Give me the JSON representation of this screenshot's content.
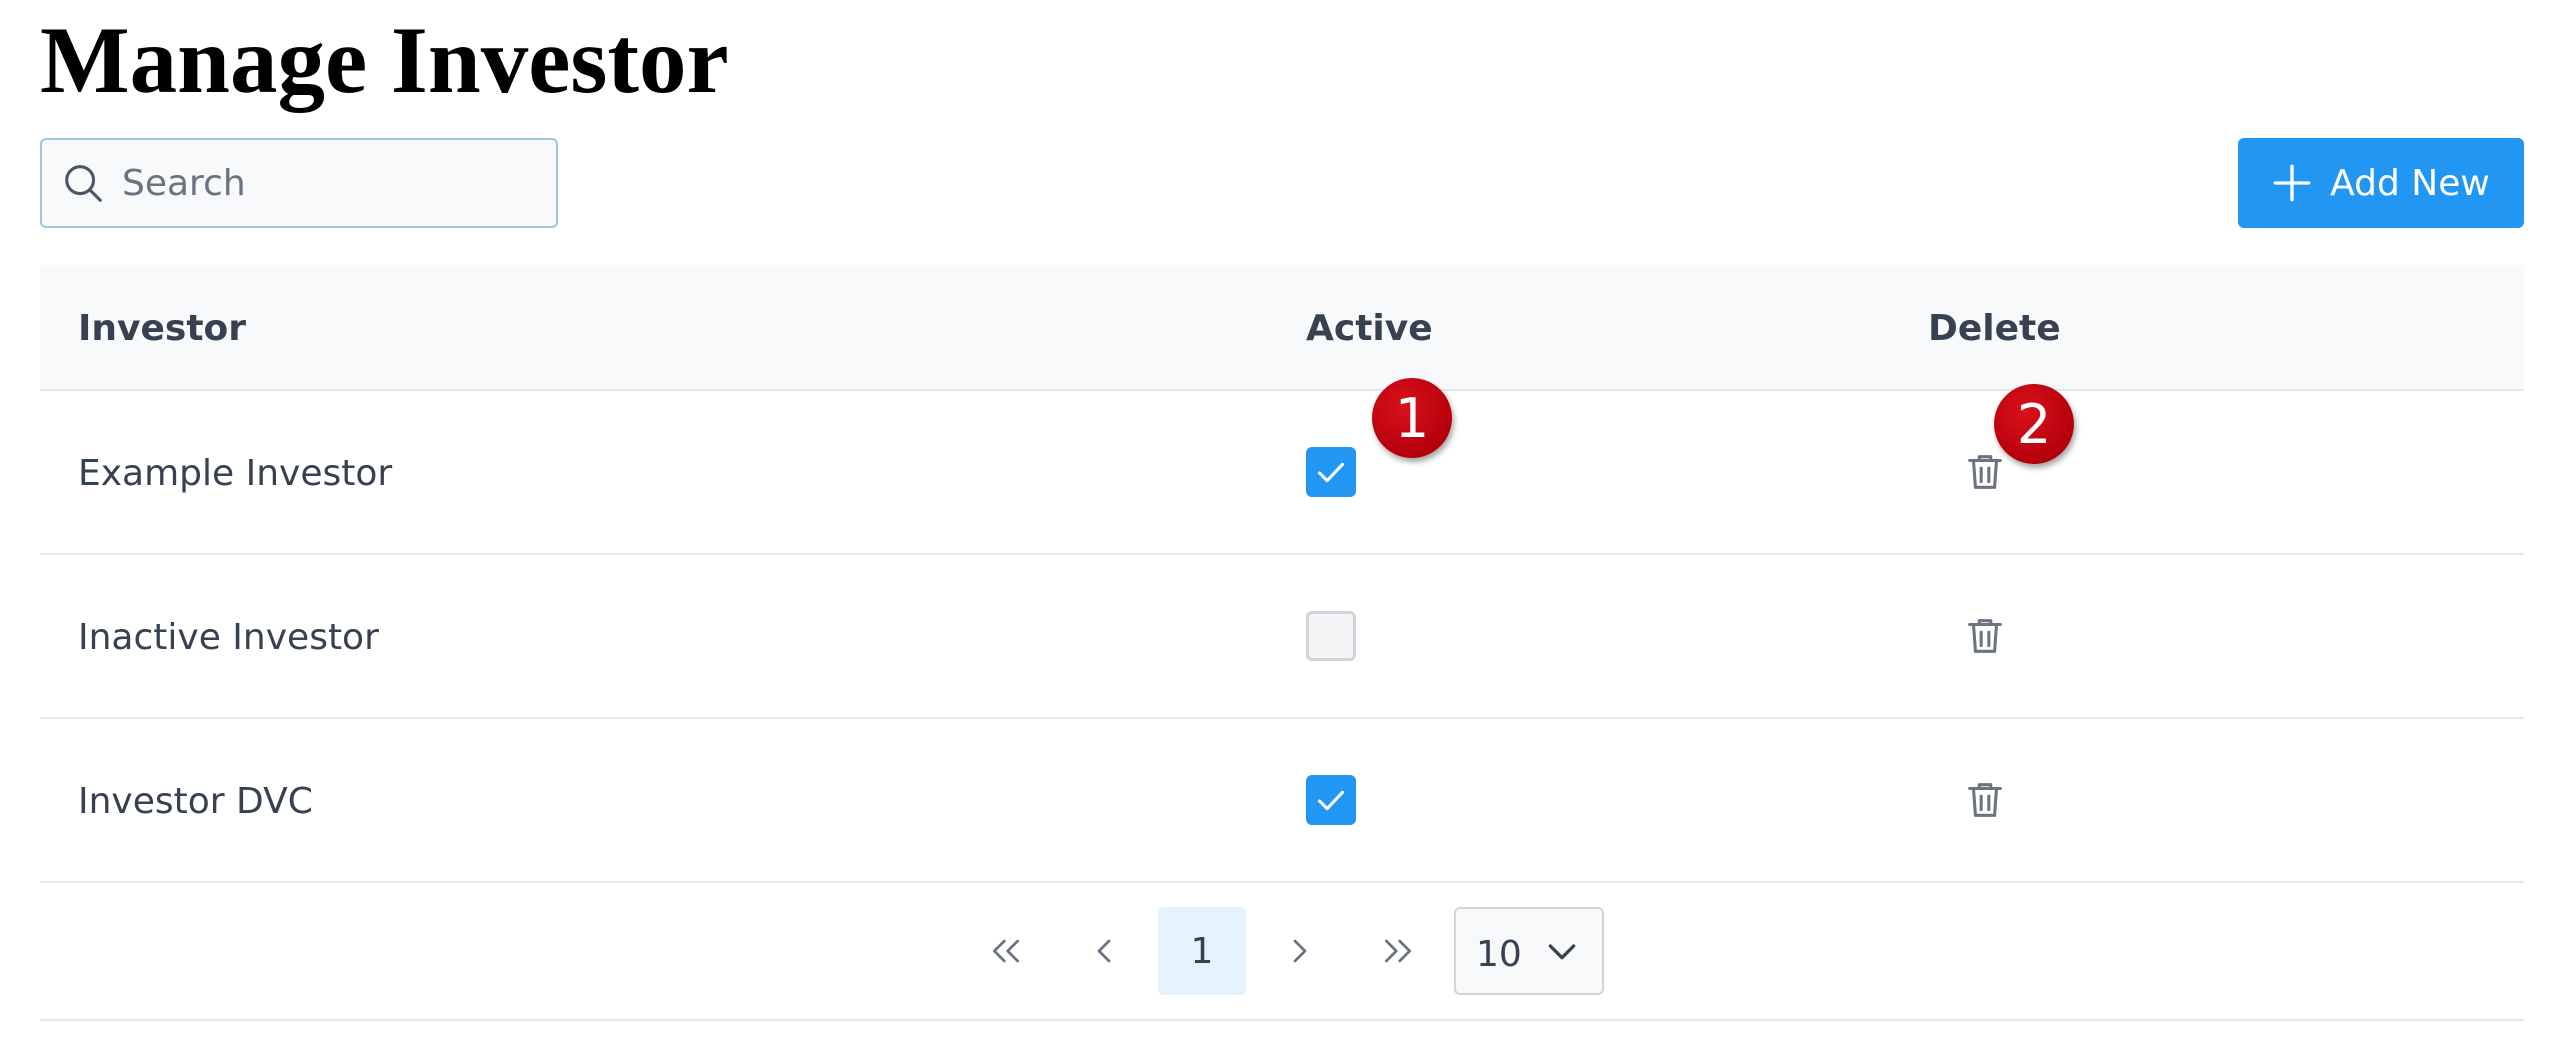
{
  "page": {
    "title": "Manage Investor"
  },
  "search": {
    "placeholder": "Search",
    "value": ""
  },
  "toolbar": {
    "add_label": "Add New"
  },
  "table": {
    "headers": {
      "investor": "Investor",
      "active": "Active",
      "delete": "Delete"
    },
    "rows": [
      {
        "name": "Example Investor",
        "active": true
      },
      {
        "name": "Inactive Investor",
        "active": false
      },
      {
        "name": "Investor DVC",
        "active": true
      }
    ]
  },
  "pagination": {
    "current_page": "1",
    "page_size": "10"
  },
  "annotations": {
    "badge1": "1",
    "badge2": "2"
  },
  "colors": {
    "accent": "#2196f3",
    "badge": "#c4000f",
    "icon": "#6b7280"
  }
}
